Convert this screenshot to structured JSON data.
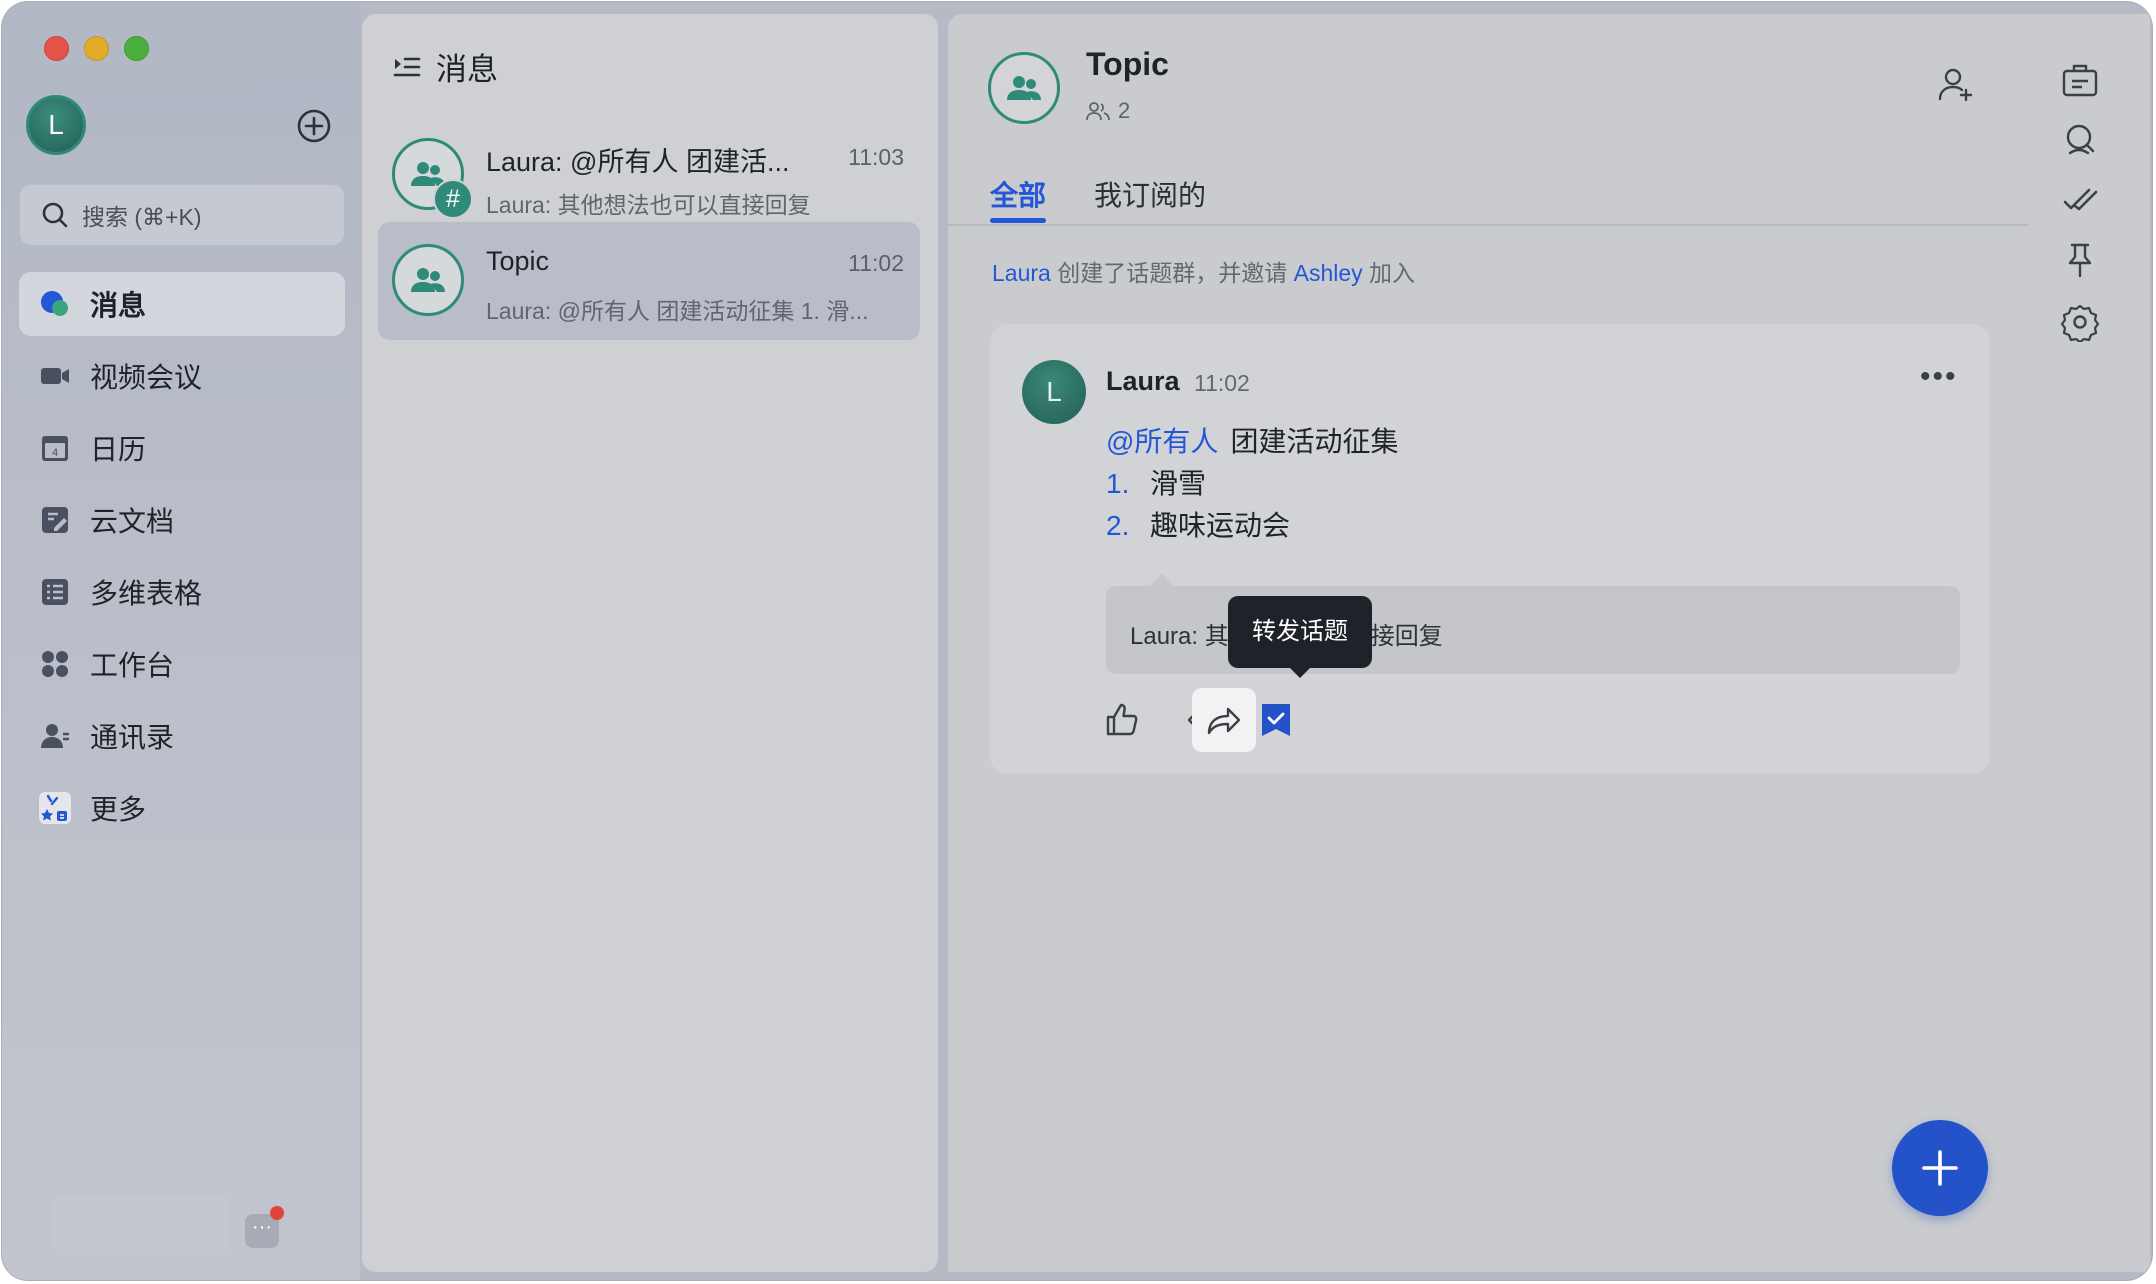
{
  "user": {
    "avatar_letter": "L"
  },
  "search": {
    "placeholder": "搜索 (⌘+K)"
  },
  "nav": {
    "items": [
      {
        "label": "消息",
        "icon": "messages-icon",
        "active": true
      },
      {
        "label": "视频会议",
        "icon": "video-meeting-icon"
      },
      {
        "label": "日历",
        "icon": "calendar-icon"
      },
      {
        "label": "云文档",
        "icon": "cloud-docs-icon"
      },
      {
        "label": "多维表格",
        "icon": "base-table-icon"
      },
      {
        "label": "工作台",
        "icon": "workplace-icon"
      },
      {
        "label": "通讯录",
        "icon": "contacts-icon"
      },
      {
        "label": "更多",
        "icon": "more-apps-icon"
      }
    ],
    "more_menu": "···"
  },
  "chatlist": {
    "title": "消息",
    "chats": [
      {
        "name": "Laura: @所有人 团建活...",
        "time": "11:03",
        "preview": "Laura: 其他想法也可以直接回复",
        "hash": "#"
      },
      {
        "name": "Topic",
        "time": "11:02",
        "preview": "Laura: @所有人 团建活动征集 1. 滑..."
      }
    ]
  },
  "conversation": {
    "title": "Topic",
    "member_count": "2",
    "tabs": [
      {
        "label": "全部",
        "active": true
      },
      {
        "label": "我订阅的"
      }
    ],
    "system_message": {
      "creator": "Laura",
      "text1": "创建了话题群，并邀请",
      "invitee": "Ashley",
      "text2": "加入"
    },
    "message": {
      "avatar_letter": "L",
      "sender": "Laura",
      "time": "11:02",
      "more": "•••",
      "mention": "@所有人",
      "heading": "团建活动征集",
      "list": [
        {
          "num": "1.",
          "text": "滑雪"
        },
        {
          "num": "2.",
          "text": "趣味运动会"
        }
      ],
      "reply_prefix": "Laura: 其",
      "reply_suffix": "直接回复",
      "tooltip": "转发话题"
    }
  },
  "colors": {
    "accent": "#2457d6",
    "group_ring": "#2f8a7a",
    "fab": "#2452c9"
  }
}
